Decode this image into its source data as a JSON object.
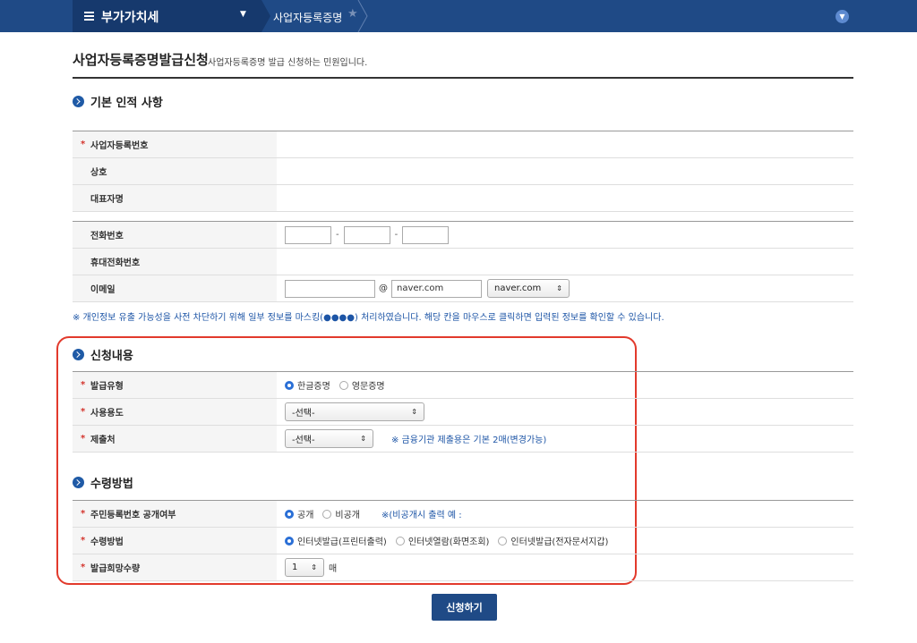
{
  "nav": {
    "menu_title": "부가가치세",
    "breadcrumb": "사업자등록증명"
  },
  "page": {
    "title": "사업자등록증명발급신청",
    "description": "사업자등록증명 발급 신청하는 민원입니다."
  },
  "sections": {
    "basic": "기본 인적 사항",
    "apply": "신청내용",
    "receive": "수령방법"
  },
  "basic_rows": {
    "biz_no": "사업자등록번호",
    "company": "상호",
    "ceo": "대표자명"
  },
  "contact_rows": {
    "phone": "전화번호",
    "mobile": "휴대전화번호",
    "email": "이메일",
    "email_domain": "naver.com",
    "email_select": "naver.com",
    "at": "@",
    "dash": "-"
  },
  "privacy_note": "※ 개인정보 유출 가능성을 사전 차단하기 위해 일부 정보를 마스킹(●●●●) 처리하였습니다. 해당 칸을 마우스로 클릭하면 입력된 정보를 확인할 수 있습니다.",
  "apply_rows": {
    "type_label": "발급유형",
    "type_opt1": "한글증명",
    "type_opt2": "영문증명",
    "purpose_label": "사용용도",
    "purpose_select": "-선택-",
    "submit_to_label": "제출처",
    "submit_to_select": "-선택-",
    "submit_to_note": "※ 금융기관 제출용은 기본 2매(변경가능)"
  },
  "receive_rows": {
    "disclose_label": "주민등록번호 공개여부",
    "disclose_opt1": "공개",
    "disclose_opt2": "비공개",
    "disclose_note": "※(비공개시 출력 예 :",
    "method_label": "수령방법",
    "method_opt1": "인터넷발급(프린터출력)",
    "method_opt2": "인터넷열람(화면조회)",
    "method_opt3": "인터넷발급(전자문서지갑)",
    "qty_label": "발급희망수량",
    "qty_value": "1",
    "qty_unit": "매"
  },
  "required_mark": "*",
  "submit_label": "신청하기",
  "colors": {
    "header": "#1f4a86",
    "accent_blue": "#1d55a6",
    "highlight_red": "#e23a2c",
    "required_red": "#d3332c"
  }
}
